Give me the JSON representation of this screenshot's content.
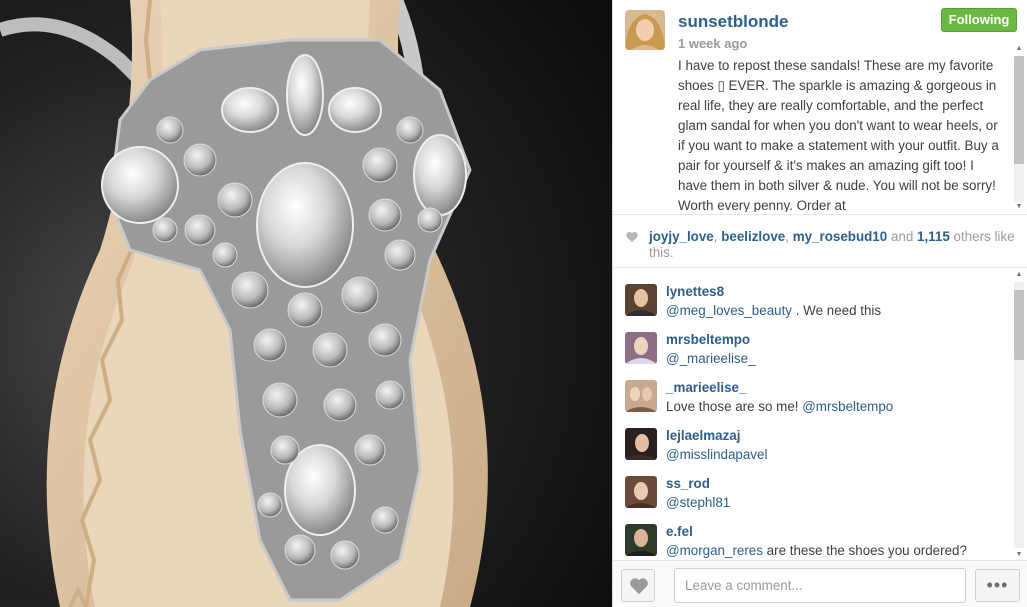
{
  "post": {
    "username": "sunsetblonde",
    "timestamp": "1 week ago",
    "follow_label": "Following",
    "caption": "I have to repost these sandals! These are my favorite shoes ▯ EVER. The sparkle is amazing & gorgeous in real life, they are really comfortable, and the perfect glam sandal for when you don't want to wear heels, or if you want to make a statement with your outfit. Buy a pair for yourself & it's makes an amazing gift too! I have them in both silver & nude. You will not be sorry! Worth every penny. Order at"
  },
  "likes": {
    "user1": "joyjy_love",
    "sep1": ", ",
    "user2": "beelizlove",
    "sep2": ", ",
    "user3": "my_rosebud10",
    "and": " and ",
    "count": "1,115",
    "rest": " others like this."
  },
  "comments": [
    {
      "user": "lynettes8",
      "mention": "@meg_loves_beauty",
      "text": " . We need this"
    },
    {
      "user": "mrsbeltempo",
      "mention": "@_marieelise_",
      "text": ""
    },
    {
      "user": "_marieelise_",
      "mention": "",
      "text": "Love those are so me! ",
      "mention2": "@mrsbeltempo"
    },
    {
      "user": "lejlaelmazaj",
      "mention": "@misslindapavel",
      "text": ""
    },
    {
      "user": "ss_rod",
      "mention": "@stephl81",
      "text": ""
    },
    {
      "user": "e.fel",
      "mention": "@morgan_reres",
      "text": " are these the shoes you ordered?"
    }
  ],
  "footer": {
    "comment_placeholder": "Leave a comment...",
    "more_label": "•••"
  },
  "icons": {
    "like": "heart-icon",
    "more": "more-dots-icon",
    "likes": "heart-small-icon"
  },
  "colors": {
    "username": "#2d5f8c",
    "follow_button": "#6bb944",
    "muted_text": "#9a9a9a"
  }
}
